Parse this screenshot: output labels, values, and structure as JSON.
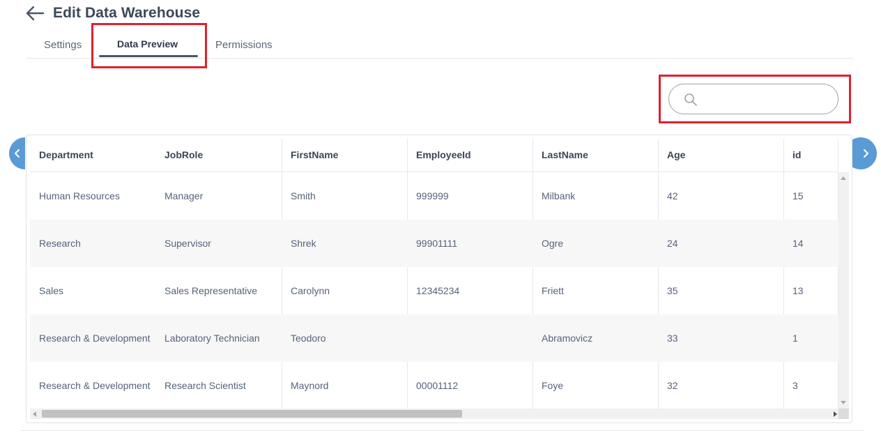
{
  "header": {
    "title": "Edit Data Warehouse",
    "back_icon": "arrow-left-icon"
  },
  "tabs": [
    {
      "label": "Settings",
      "active": false
    },
    {
      "label": "Data Preview",
      "active": true
    },
    {
      "label": "Permissions",
      "active": false
    }
  ],
  "search": {
    "value": "",
    "placeholder": "",
    "icon": "search-icon"
  },
  "table": {
    "columns": [
      "Department",
      "JobRole",
      "FirstName",
      "EmployeeId",
      "LastName",
      "Age",
      "id"
    ],
    "rows": [
      [
        "Human Resources",
        "Manager",
        "Smith",
        "999999",
        "Milbank",
        "42",
        "15"
      ],
      [
        "Research",
        "Supervisor",
        "Shrek",
        "99901111",
        "Ogre",
        "24",
        "14"
      ],
      [
        "Sales",
        "Sales Representative",
        "Carolynn",
        "12345234",
        "Friett",
        "35",
        "13"
      ],
      [
        "Research & Development",
        "Laboratory Technician",
        "Teodoro",
        "",
        "Abramovicz",
        "33",
        "1"
      ],
      [
        "Research & Development",
        "Research Scientist",
        "Maynord",
        "00001112",
        "Foye",
        "32",
        "3"
      ]
    ]
  },
  "nav": {
    "prev_icon": "chevron-left-icon",
    "next_icon": "chevron-right-icon"
  },
  "colors": {
    "highlight": "#e0202d",
    "nav_button": "#5b9bd5",
    "tab_underline": "#4a5566"
  }
}
